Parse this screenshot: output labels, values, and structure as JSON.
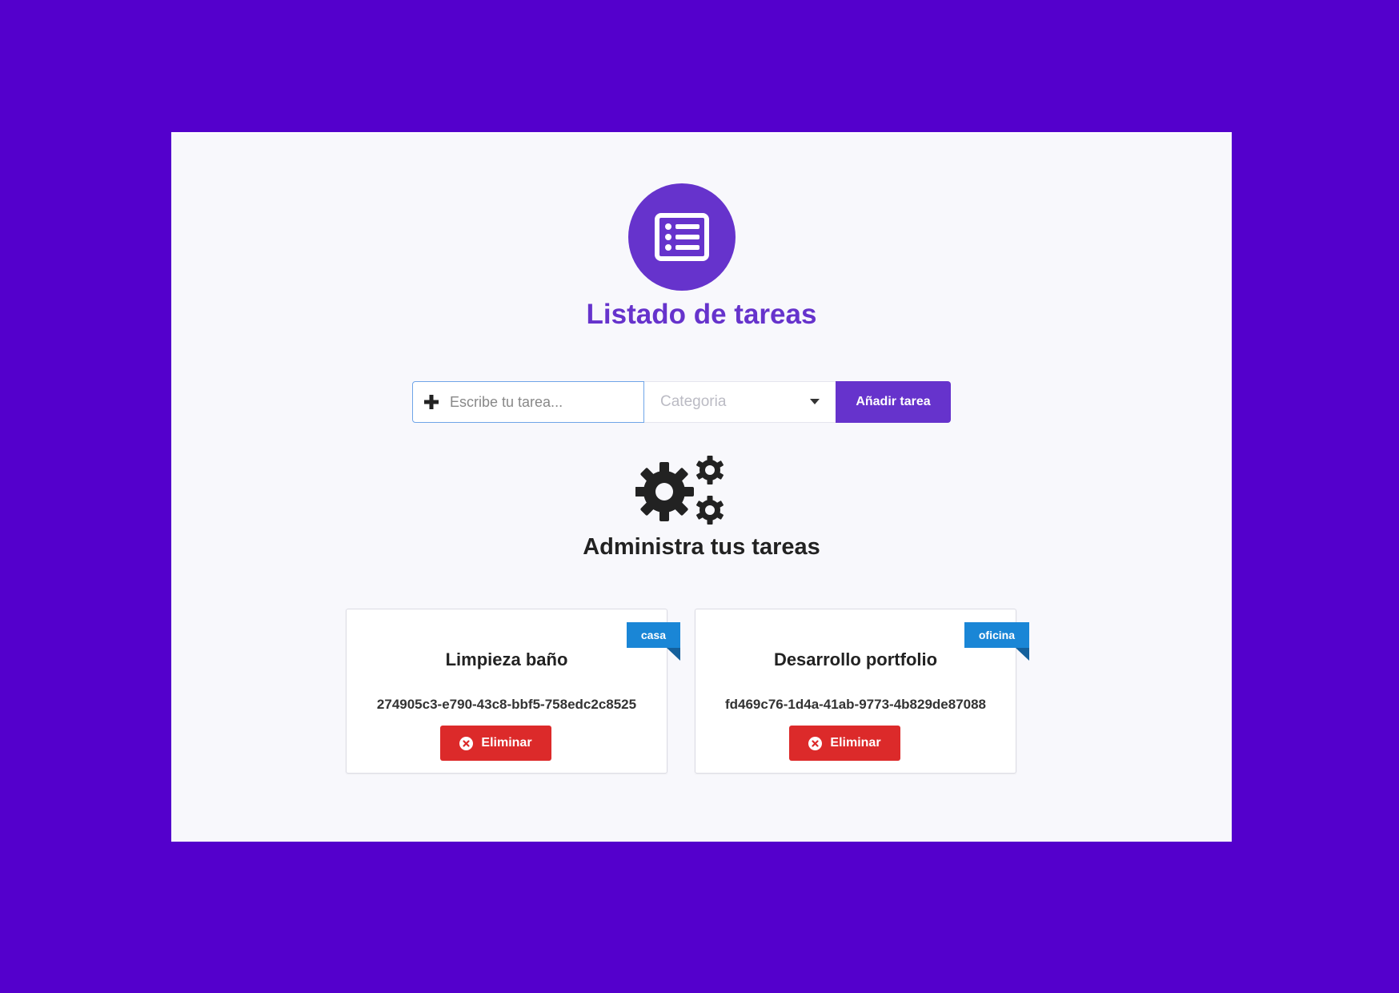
{
  "header": {
    "icon": "list-alt-icon",
    "title": "Listado de tareas"
  },
  "form": {
    "add_icon": "plus-icon",
    "task_placeholder": "Escribe tu tarea...",
    "task_value": "",
    "category_placeholder": "Categoria",
    "category_icon": "caret-down-icon",
    "submit_label": "Añadir tarea"
  },
  "section": {
    "icon": "cogs-icon",
    "title": "Administra tus tareas"
  },
  "tasks": [
    {
      "title": "Limpieza baño",
      "id": "274905c3-e790-43c8-bbf5-758edc2c8525",
      "category": "casa",
      "delete_label": "Eliminar",
      "delete_icon": "times-circle-icon"
    },
    {
      "title": "Desarrollo portfolio",
      "id": "fd469c76-1d4a-41ab-9773-4b829de87088",
      "category": "oficina",
      "delete_label": "Eliminar",
      "delete_icon": "times-circle-icon"
    }
  ],
  "colors": {
    "background": "#5400cc",
    "accent": "#6633cc",
    "badge": "#1a86d6",
    "danger": "#dc2a2a"
  }
}
